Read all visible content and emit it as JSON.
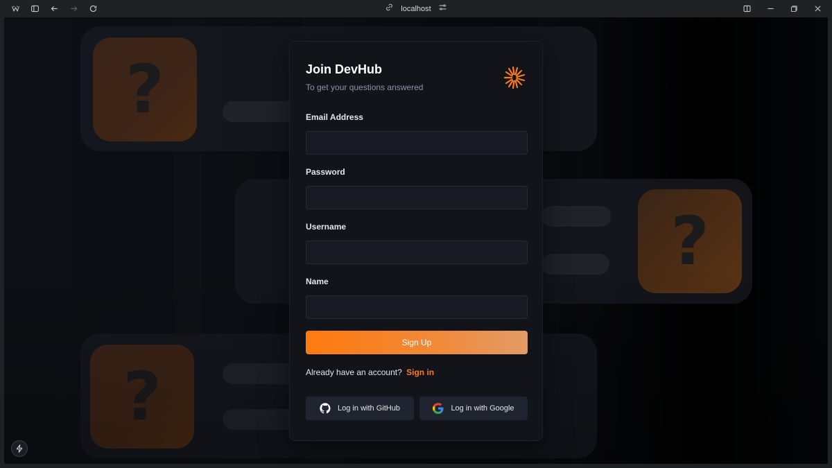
{
  "browser": {
    "url": "localhost",
    "icons": {
      "app": "browser-logo-icon",
      "sidebar": "sidebar-toggle-icon",
      "back": "arrow-left-icon",
      "forward": "arrow-right-icon",
      "reload": "reload-icon",
      "link": "link-icon",
      "site_settings": "sliders-icon",
      "split": "split-view-icon",
      "minimize": "minimize-icon",
      "restore": "restore-icon",
      "close": "close-icon"
    }
  },
  "background": {
    "tile_glyph": "?"
  },
  "form": {
    "title": "Join DevHub",
    "subtitle": "To get your questions answered",
    "fields": [
      {
        "label": "Email Address",
        "value": ""
      },
      {
        "label": "Password",
        "value": ""
      },
      {
        "label": "Username",
        "value": ""
      },
      {
        "label": "Name",
        "value": ""
      }
    ],
    "submit_label": "Sign Up",
    "account_prompt": "Already have an account?",
    "signin_link": "Sign in",
    "github_label": "Log in with GitHub",
    "google_label": "Log in with Google",
    "accent_color": "#ff7a1a"
  },
  "devtools": {
    "icon": "lightning-bolt-icon"
  }
}
